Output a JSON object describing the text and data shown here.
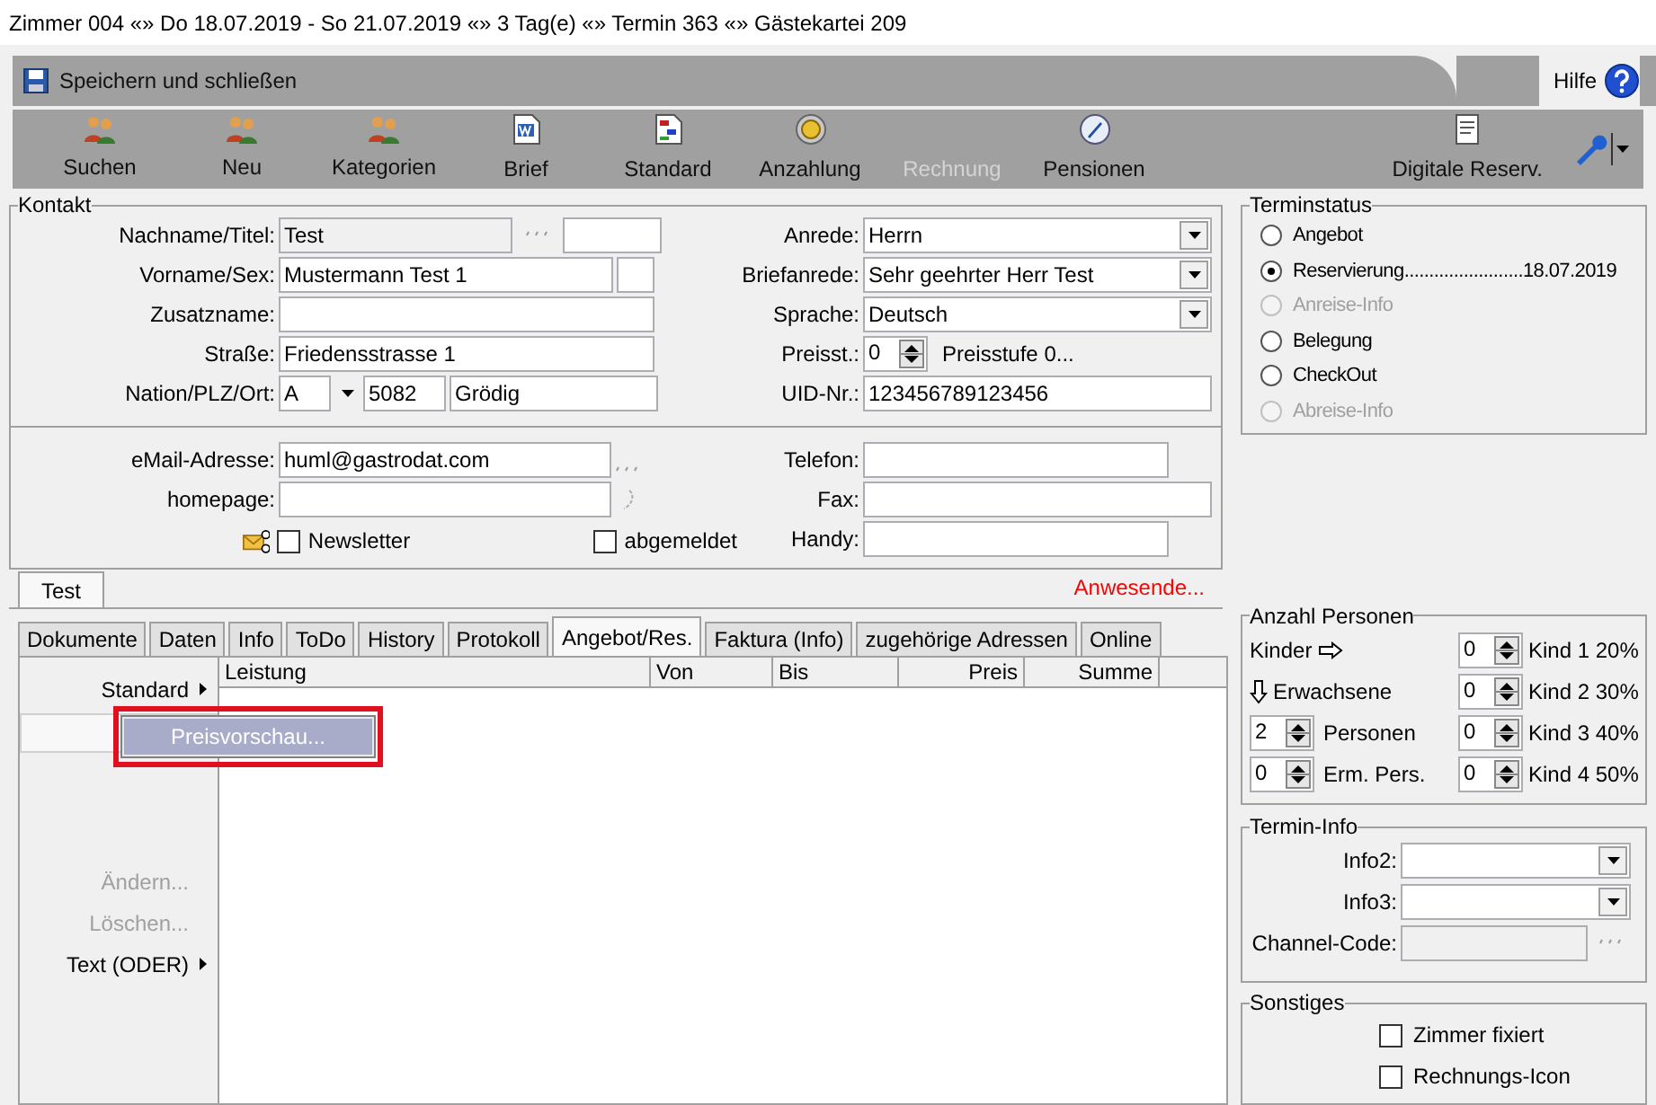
{
  "title": "Zimmer 004 «» Do 18.07.2019 - So 21.07.2019 «» 3 Tag(e) «» Termin 363 «» Gästekartei 209",
  "header": {
    "save_label": "Speichern und schließen",
    "help_label": "Hilfe"
  },
  "toolbar": [
    {
      "label": "Suchen",
      "kind": "people",
      "disabled": false
    },
    {
      "label": "Neu",
      "kind": "people",
      "disabled": false
    },
    {
      "label": "Kategorien",
      "kind": "people",
      "disabled": false
    },
    {
      "label": "Brief",
      "kind": "letter",
      "disabled": false
    },
    {
      "label": "Standard",
      "kind": "chart",
      "disabled": false
    },
    {
      "label": "Anzahlung",
      "kind": "coin",
      "disabled": false
    },
    {
      "label": "Rechnung",
      "kind": "none",
      "disabled": true
    },
    {
      "label": "Pensionen",
      "kind": "pen",
      "disabled": false
    }
  ],
  "toolbar_right": {
    "label": "Digitale Reserv."
  },
  "contact": {
    "legend": "Kontakt",
    "nachname": {
      "label": "Nachname/Titel:",
      "value": "Test"
    },
    "vorname": {
      "label": "Vorname/Sex:",
      "value": "Mustermann Test 1"
    },
    "zusatzname": {
      "label": "Zusatzname:"
    },
    "strasse": {
      "label": "Straße:",
      "value": "Friedensstrasse 1"
    },
    "ort": {
      "label": "Nation/PLZ/Ort:",
      "nation": "A",
      "plz": "5082",
      "city": "Grödig"
    },
    "email": {
      "label": "eMail-Adresse:",
      "value": "huml@gastrodat.com"
    },
    "homepage": {
      "label": "homepage:"
    },
    "newsletter": {
      "label": "Newsletter",
      "checked": false
    },
    "abgemeldet": {
      "label": "abgemeldet",
      "checked": false
    },
    "anrede": {
      "label": "Anrede:",
      "value": "Herrn"
    },
    "briefanrede": {
      "label": "Briefanrede:",
      "value": "Sehr geehrter Herr Test"
    },
    "sprache": {
      "label": "Sprache:",
      "value": "Deutsch"
    },
    "preisstufe": {
      "label": "Preisst.:",
      "value": "0",
      "note": "Preisstufe 0..."
    },
    "uid": {
      "label": "UID-Nr.:",
      "value": "123456789123456"
    },
    "telefon": {
      "label": "Telefon:"
    },
    "fax": {
      "label": "Fax:"
    },
    "handy": {
      "label": "Handy:"
    }
  },
  "record_tab": {
    "label": "Test",
    "selected": true
  },
  "anwesende": "Anwesende...",
  "tabs": [
    {
      "label": "Dokumente",
      "selected": false
    },
    {
      "label": "Daten",
      "selected": false
    },
    {
      "label": "Info",
      "selected": false
    },
    {
      "label": "ToDo",
      "selected": false
    },
    {
      "label": "History",
      "selected": false
    },
    {
      "label": "Protokoll",
      "selected": false
    },
    {
      "label": "Angebot/Res.",
      "selected": true
    },
    {
      "label": "Faktura (Info)",
      "selected": false
    },
    {
      "label": "zugehörige Adressen",
      "selected": false
    },
    {
      "label": "Online",
      "selected": false
    }
  ],
  "side_menu": [
    {
      "label": "Standard",
      "submenu": true,
      "disabled": false,
      "kind": "item"
    },
    {
      "kind": "blank"
    },
    {
      "label": "Ändern...",
      "submenu": false,
      "disabled": true,
      "kind": "item"
    },
    {
      "label": "Löschen...",
      "submenu": false,
      "disabled": true,
      "kind": "item"
    },
    {
      "label": "Text (ODER)",
      "submenu": true,
      "disabled": false,
      "kind": "item"
    }
  ],
  "popup": {
    "label": "Preisvorschau...",
    "highlighted": true
  },
  "table": {
    "columns": [
      {
        "label": "Leistung"
      },
      {
        "label": "Von"
      },
      {
        "label": "Bis"
      },
      {
        "label": "Preis"
      },
      {
        "label": "Summe"
      }
    ]
  },
  "terminstatus": {
    "legend": "Terminstatus",
    "options": [
      {
        "label": "Angebot",
        "selected": false,
        "disabled": false
      },
      {
        "label": "Reservierung........................18.07.2019",
        "selected": true,
        "disabled": false
      },
      {
        "label": "Anreise-Info",
        "selected": false,
        "disabled": true
      },
      {
        "label": "Belegung",
        "selected": false,
        "disabled": false
      },
      {
        "label": "CheckOut",
        "selected": false,
        "disabled": false
      },
      {
        "label": "Abreise-Info",
        "selected": false,
        "disabled": true
      }
    ]
  },
  "persons": {
    "legend": "Anzahl Personen",
    "kinder": "Kinder",
    "erwachsene": "Erwachsene",
    "left": [
      {
        "value": "2",
        "label": "Personen"
      },
      {
        "value": "0",
        "label": "Erm. Pers."
      }
    ],
    "right": [
      {
        "value": "0",
        "label": "Kind 1 20%"
      },
      {
        "value": "0",
        "label": "Kind 2 30%"
      },
      {
        "value": "0",
        "label": "Kind 3 40%"
      },
      {
        "value": "0",
        "label": "Kind 4 50%"
      }
    ]
  },
  "termin_info": {
    "legend": "Termin-Info",
    "info2": "Info2:",
    "info3": "Info3:",
    "channel": "Channel-Code:"
  },
  "sonstiges": {
    "legend": "Sonstiges",
    "checks": [
      {
        "label": "Zimmer fixiert",
        "checked": false
      },
      {
        "label": "Rechnungs-Icon",
        "checked": false
      }
    ]
  }
}
